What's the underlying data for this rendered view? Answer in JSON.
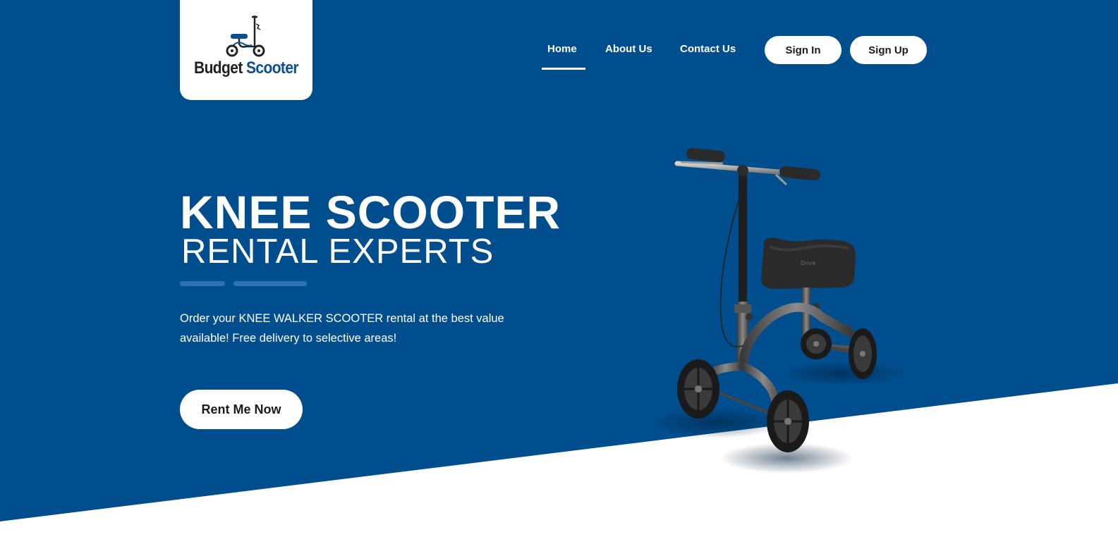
{
  "colors": {
    "hero_background": "#004e8e",
    "accent_bar": "#2e73ad",
    "brand_blue": "#0b4f93",
    "white": "#ffffff",
    "button_text": "#1d1d1d"
  },
  "logo": {
    "word1": "Budget",
    "word2": "Scooter",
    "icon": "scooter-icon"
  },
  "nav": {
    "items": [
      {
        "label": "Home",
        "active": true
      },
      {
        "label": "About Us",
        "active": false
      },
      {
        "label": "Contact Us",
        "active": false
      }
    ],
    "sign_in": "Sign In",
    "sign_up": "Sign Up"
  },
  "hero": {
    "title": "KNEE SCOOTER",
    "subtitle": "RENTAL EXPERTS",
    "description": "Order your KNEE WALKER SCOOTER rental at the best value available! Free delivery to selective areas!",
    "cta_label": "Rent Me Now",
    "image": "knee-scooter-product-image"
  }
}
